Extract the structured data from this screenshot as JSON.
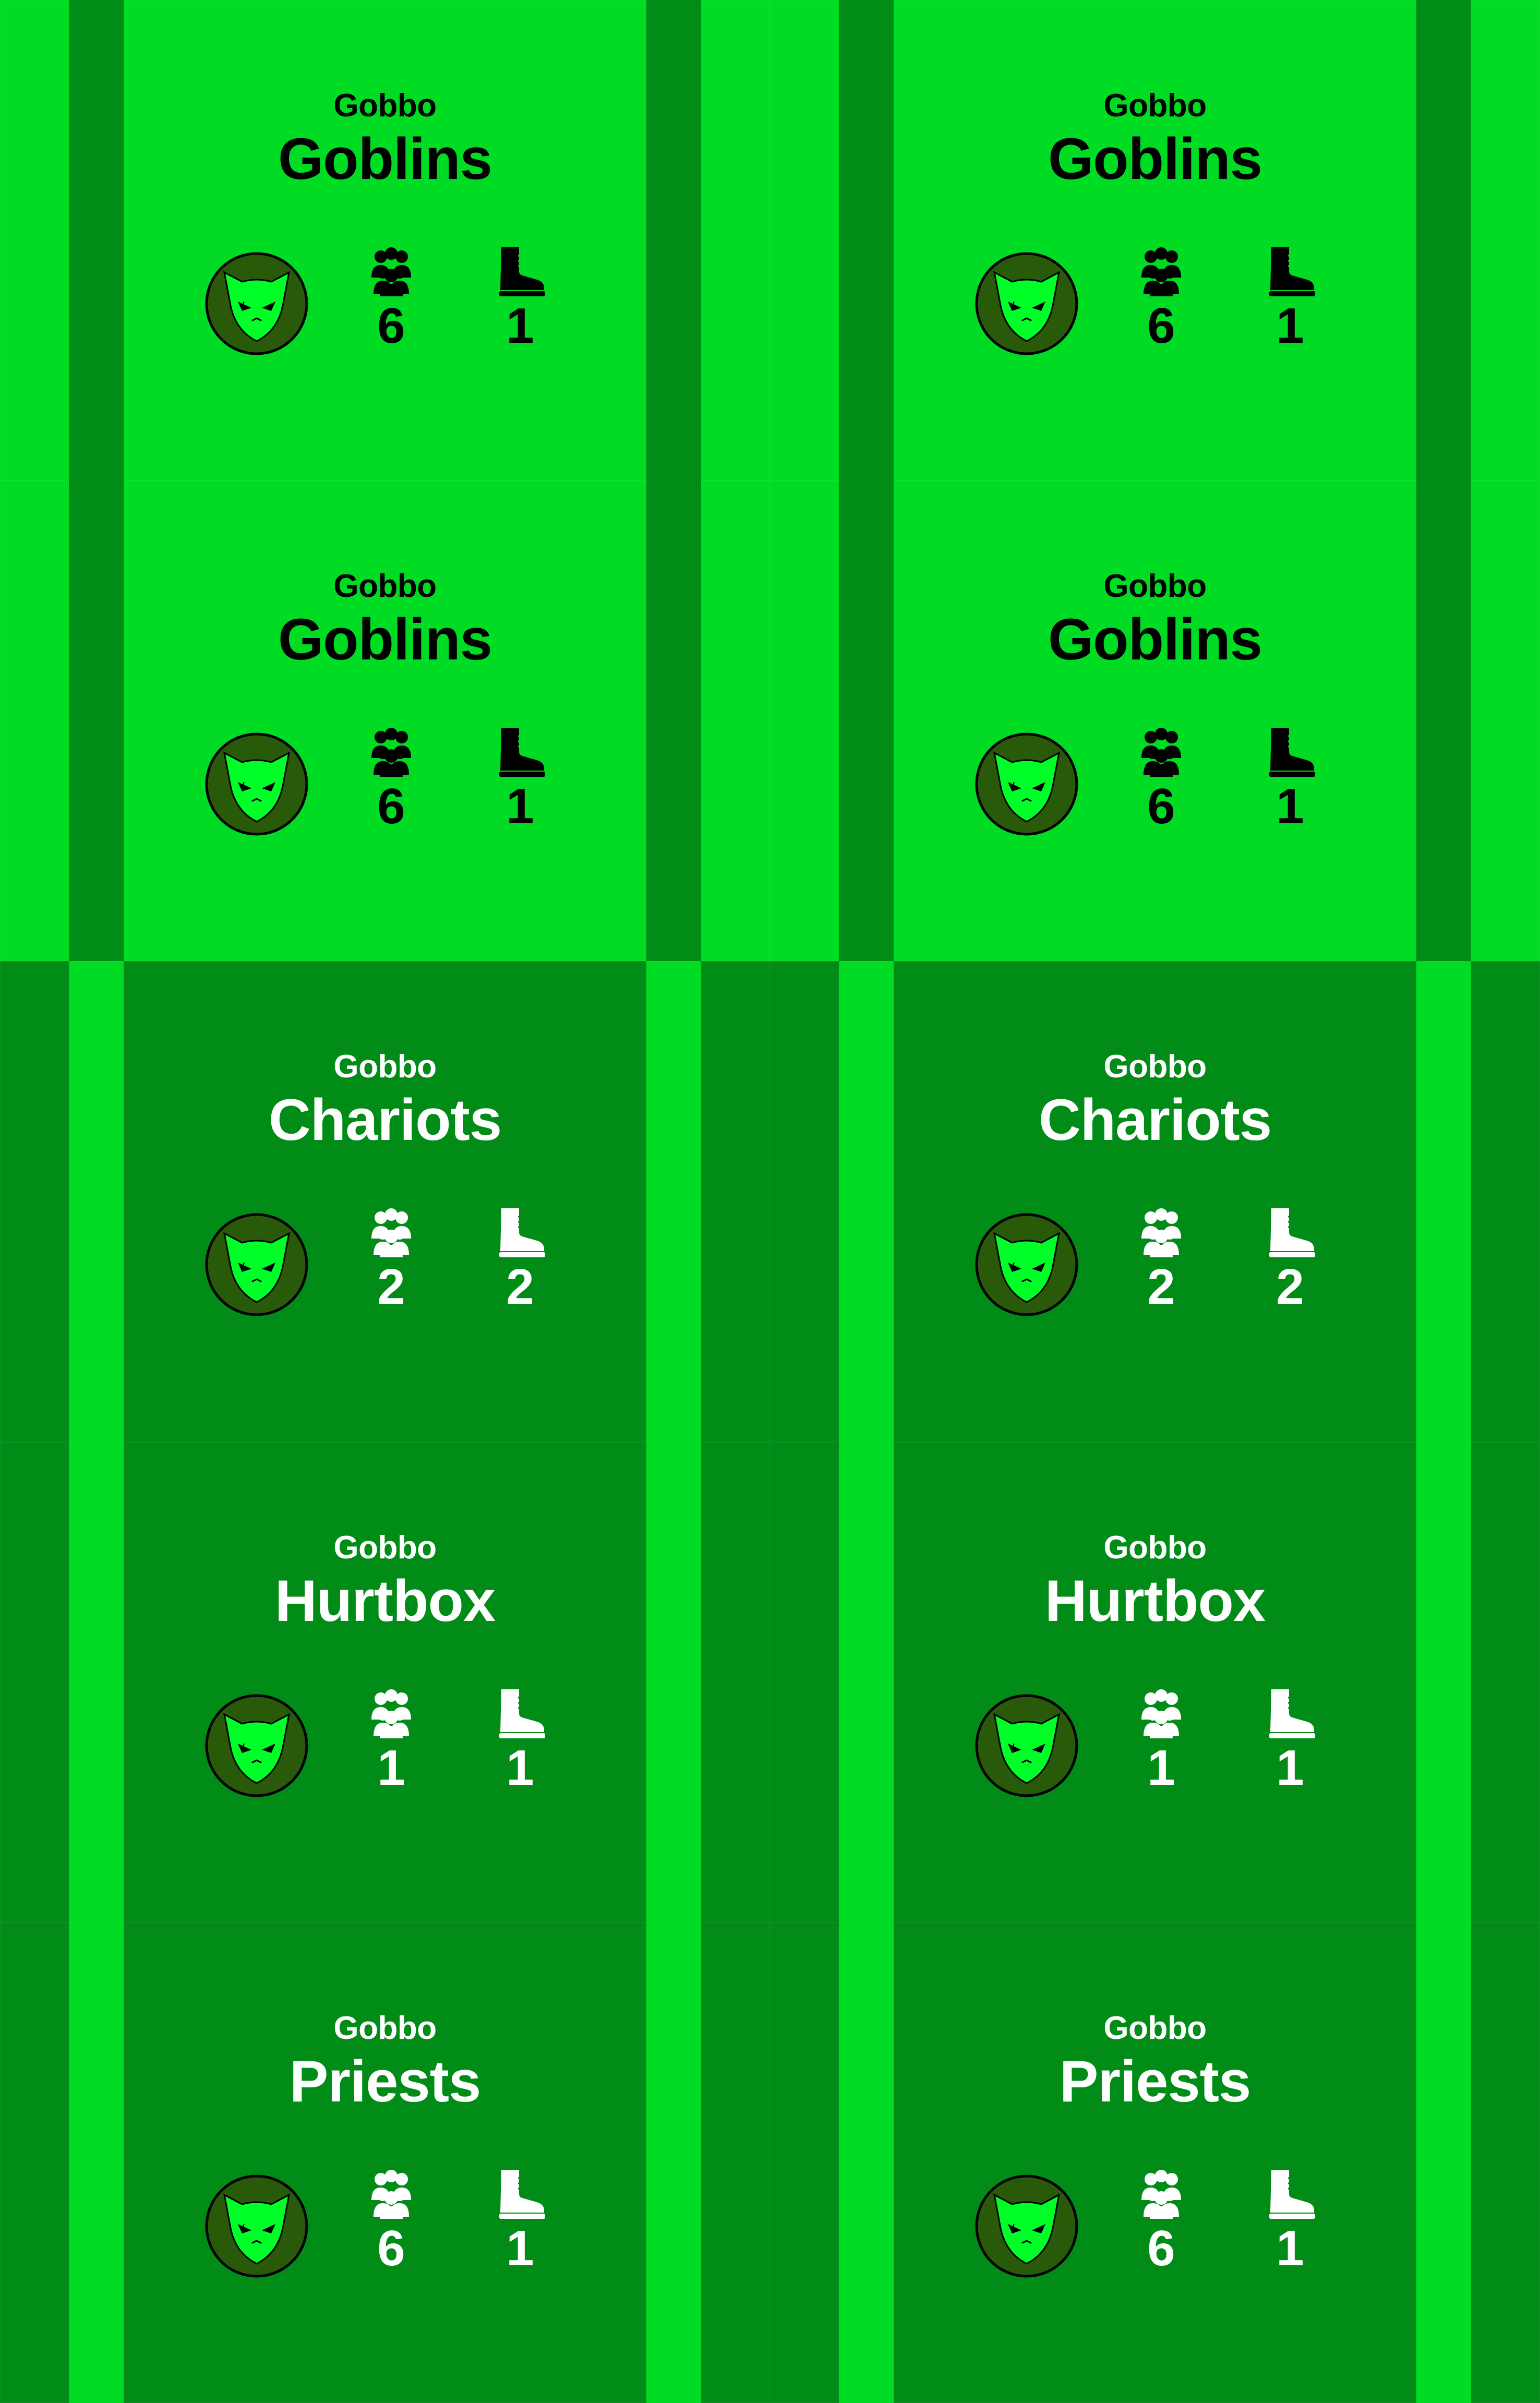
{
  "colors": {
    "light_green": "#00dc23",
    "dark_green": "#008c16",
    "badge_fill": "#285a0a",
    "face_fill": "#00ff28"
  },
  "icons": {
    "faction": "goblin-face-icon",
    "units": "group-of-people-icon",
    "movement": "boot-icon"
  },
  "cards": [
    {
      "faction": "Gobbo",
      "name": "Goblins",
      "units": "6",
      "move": "1",
      "theme": "light"
    },
    {
      "faction": "Gobbo",
      "name": "Goblins",
      "units": "6",
      "move": "1",
      "theme": "light"
    },
    {
      "faction": "Gobbo",
      "name": "Goblins",
      "units": "6",
      "move": "1",
      "theme": "light"
    },
    {
      "faction": "Gobbo",
      "name": "Goblins",
      "units": "6",
      "move": "1",
      "theme": "light"
    },
    {
      "faction": "Gobbo",
      "name": "Chariots",
      "units": "2",
      "move": "2",
      "theme": "dark"
    },
    {
      "faction": "Gobbo",
      "name": "Chariots",
      "units": "2",
      "move": "2",
      "theme": "dark"
    },
    {
      "faction": "Gobbo",
      "name": "Hurtbox",
      "units": "1",
      "move": "1",
      "theme": "dark"
    },
    {
      "faction": "Gobbo",
      "name": "Hurtbox",
      "units": "1",
      "move": "1",
      "theme": "dark"
    },
    {
      "faction": "Gobbo",
      "name": "Priests",
      "units": "6",
      "move": "1",
      "theme": "dark"
    },
    {
      "faction": "Gobbo",
      "name": "Priests",
      "units": "6",
      "move": "1",
      "theme": "dark"
    }
  ]
}
